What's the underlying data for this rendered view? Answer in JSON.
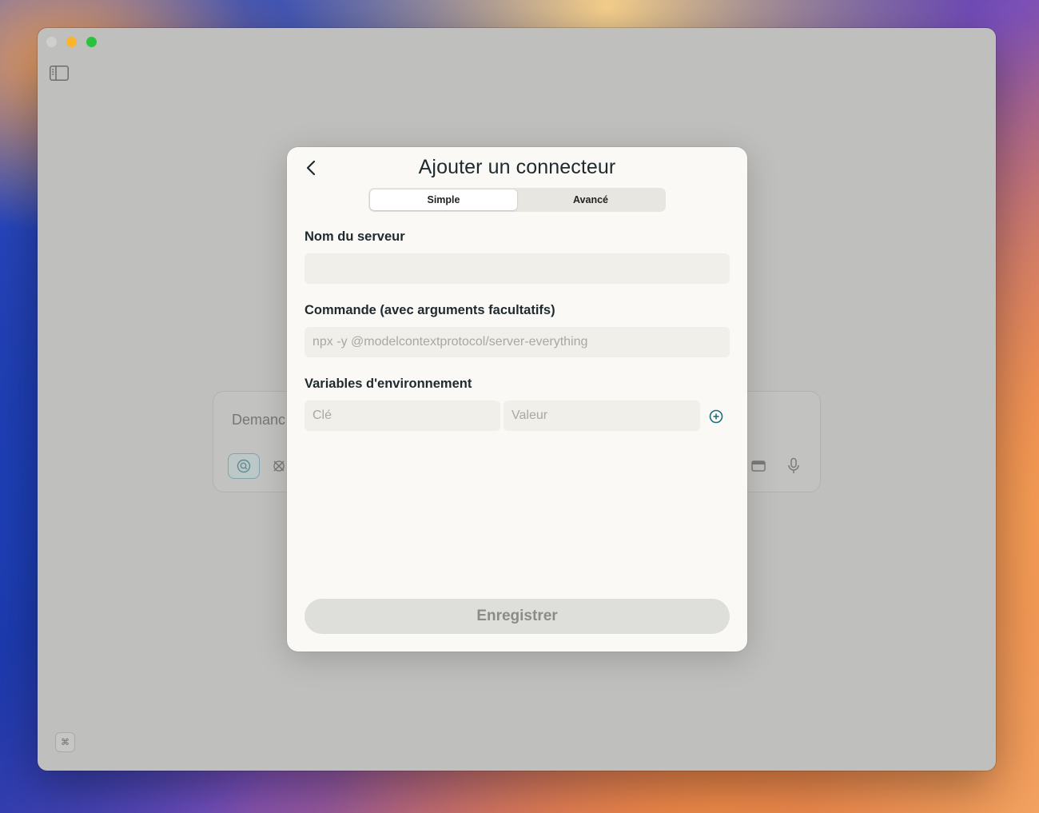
{
  "window": {
    "traffic_lights": [
      "close",
      "minimize",
      "maximize"
    ]
  },
  "composer": {
    "placeholder": "Demanc"
  },
  "bottom_shortcut": {
    "glyph": "⌘"
  },
  "modal": {
    "title": "Ajouter un connecteur",
    "tabs": [
      {
        "label": "Simple",
        "active": true
      },
      {
        "label": "Avancé",
        "active": false
      }
    ],
    "server_name": {
      "label": "Nom du serveur",
      "value": "",
      "placeholder": ""
    },
    "command": {
      "label": "Commande (avec arguments facultatifs)",
      "value": "",
      "placeholder": "npx -y @modelcontextprotocol/server-everything"
    },
    "env": {
      "label": "Variables d'environnement",
      "key_placeholder": "Clé",
      "value_placeholder": "Valeur"
    },
    "save_label": "Enregistrer"
  },
  "colors": {
    "accent": "#1f6f7a",
    "modal_bg": "#faf9f5",
    "field_bg": "#f0efe9",
    "window_dim": "#bfbfbd"
  }
}
